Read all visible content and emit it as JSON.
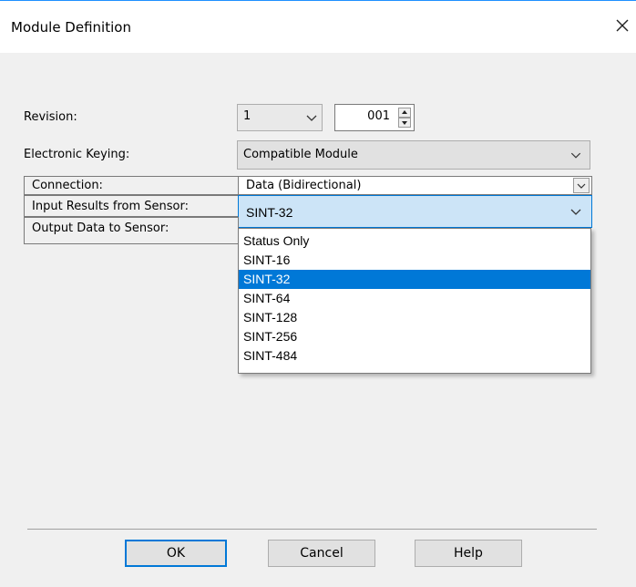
{
  "window": {
    "title": "Module Definition"
  },
  "revision": {
    "label": "Revision:",
    "major": "1",
    "minor": "001"
  },
  "electronic_keying": {
    "label": "Electronic Keying:",
    "value": "Compatible Module"
  },
  "grid": {
    "connection": {
      "label": "Connection:",
      "value": "Data (Bidirectional)"
    },
    "input": {
      "label": "Input Results from Sensor:",
      "value": "SINT-32"
    },
    "output": {
      "label": "Output Data to Sensor:"
    }
  },
  "dropdown": {
    "options": [
      "Status Only",
      "SINT-16",
      "SINT-32",
      "SINT-64",
      "SINT-128",
      "SINT-256",
      "SINT-484"
    ],
    "selected_index": 2
  },
  "buttons": {
    "ok": "OK",
    "cancel": "Cancel",
    "help": "Help"
  },
  "colors": {
    "accent": "#0078d7",
    "combo_highlight": "#cce4f7"
  }
}
